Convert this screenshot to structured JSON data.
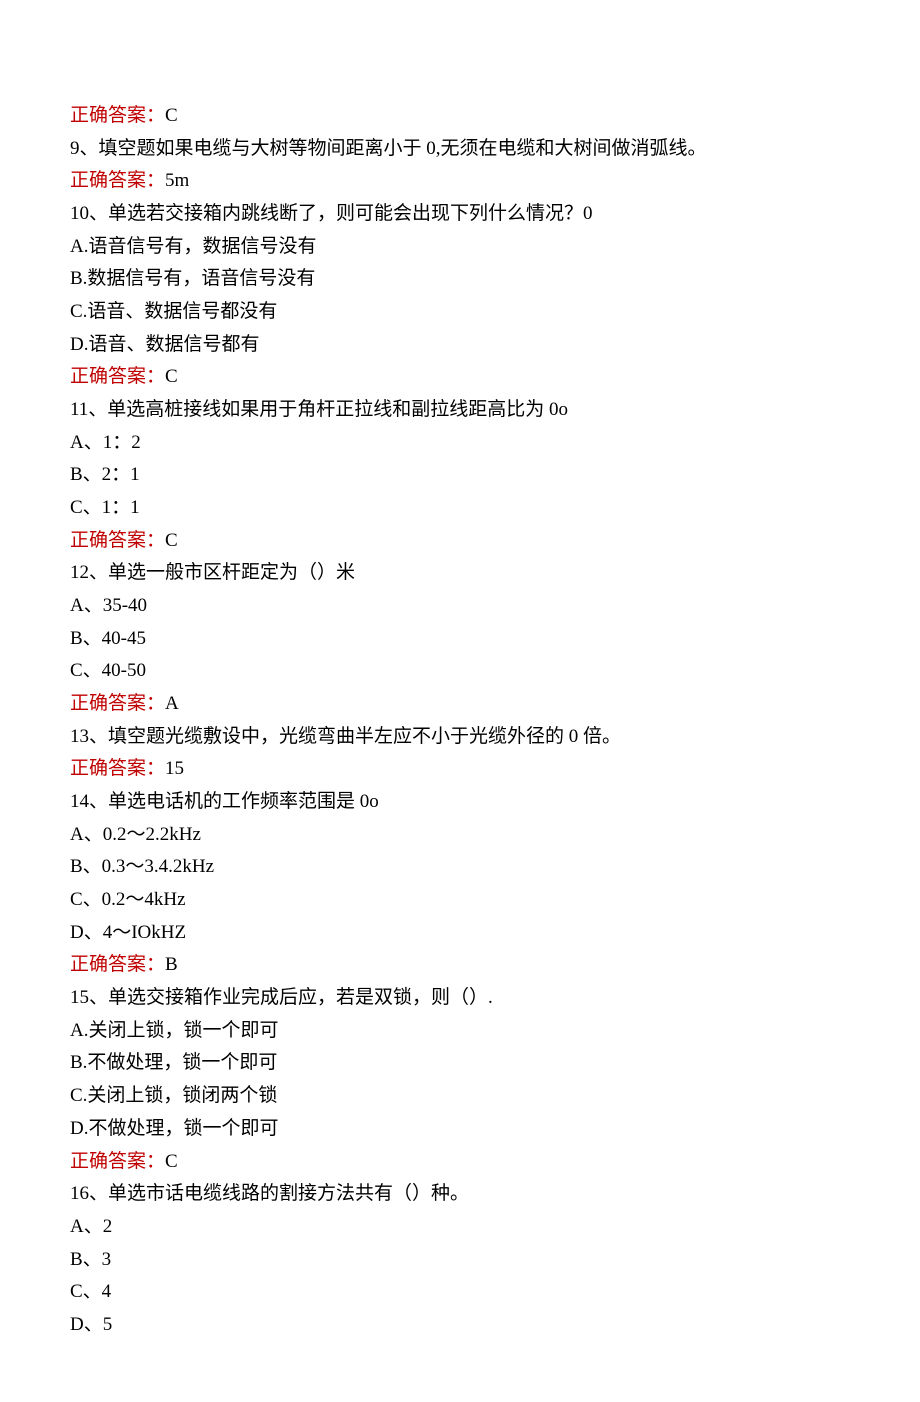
{
  "lines": [
    {
      "red": "正确答案：",
      "black": "C"
    },
    {
      "black": "9、填空题如果电缆与大树等物间距离小于 0,无须在电缆和大树间做消弧线。"
    },
    {
      "red": "正确答案：",
      "black": "5m"
    },
    {
      "black": "10、单选若交接箱内跳线断了，则可能会出现下列什么情况？0"
    },
    {
      "black": "A.语音信号有，数据信号没有"
    },
    {
      "black": "B.数据信号有，语音信号没有"
    },
    {
      "black": "C.语音、数据信号都没有"
    },
    {
      "black": "D.语音、数据信号都有"
    },
    {
      "red": "正确答案：",
      "black": "C"
    },
    {
      "black": "11、单选高桩接线如果用于角杆正拉线和副拉线距高比为 0o"
    },
    {
      "black": "A、1：2"
    },
    {
      "black": "B、2：1"
    },
    {
      "black": "C、1：1"
    },
    {
      "red": "正确答案：",
      "black": "C"
    },
    {
      "black": "12、单选一般市区杆距定为（）米"
    },
    {
      "black": "A、35-40"
    },
    {
      "black": "B、40-45"
    },
    {
      "black": "C、40-50"
    },
    {
      "red": "正确答案：",
      "black": "A"
    },
    {
      "black": "13、填空题光缆敷设中，光缆弯曲半左应不小于光缆外径的 0 倍。"
    },
    {
      "red": "正确答案：",
      "black": "15"
    },
    {
      "black": "14、单选电话机的工作频率范围是 0o"
    },
    {
      "black": "A、0.2～2.2kHz"
    },
    {
      "black": "B、0.3～3.4.2kHz"
    },
    {
      "black": "C、0.2～4kHz"
    },
    {
      "black": "D、4～IOkHZ"
    },
    {
      "red": "正确答案：",
      "black": "B"
    },
    {
      "black": "15、单选交接箱作业完成后应，若是双锁，则（）."
    },
    {
      "black": "A.关闭上锁，锁一个即可"
    },
    {
      "black": "B.不做处理，锁一个即可"
    },
    {
      "black": "C.关闭上锁，锁闭两个锁"
    },
    {
      "black": "D.不做处理，锁一个即可"
    },
    {
      "red": "正确答案：",
      "black": "C"
    },
    {
      "black": "16、单选市话电缆线路的割接方法共有（）种。"
    },
    {
      "black": "A、2"
    },
    {
      "black": "B、3"
    },
    {
      "black": "C、4"
    },
    {
      "black": "D、5"
    }
  ]
}
